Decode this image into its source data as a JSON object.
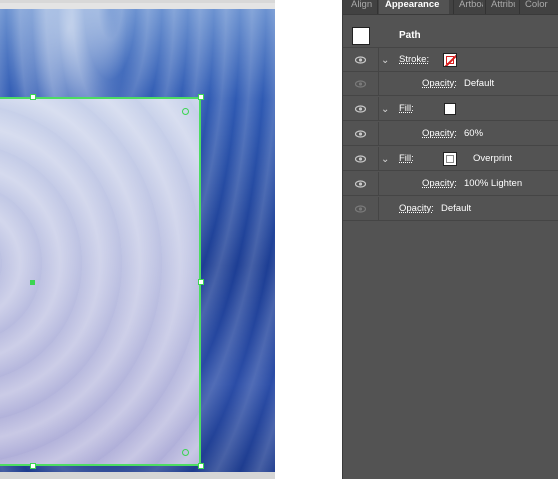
{
  "panel": {
    "tabs": [
      {
        "label": "Align",
        "active": false
      },
      {
        "label": "Appearance",
        "active": true
      },
      {
        "label": "Artboards",
        "active": false
      },
      {
        "label": "Attributes",
        "active": false
      },
      {
        "label": "Color",
        "active": false
      }
    ],
    "object_type": "Path",
    "rows": [
      {
        "kind": "stroke",
        "label": "Stroke:",
        "swatch": "none-icon",
        "visible": true
      },
      {
        "kind": "opacity",
        "label": "Opacity:",
        "value": "Default",
        "visible": false
      },
      {
        "kind": "fill",
        "label": "Fill:",
        "swatch": "white",
        "visible": true
      },
      {
        "kind": "opacity",
        "label": "Opacity:",
        "value": "60%",
        "visible": true
      },
      {
        "kind": "fill",
        "label": "Fill:",
        "swatch": "white-stroke-outline",
        "extra": "Overprint",
        "visible": true
      },
      {
        "kind": "opacity",
        "label": "Opacity:",
        "value": "100% Lighten",
        "visible": true
      },
      {
        "kind": "opacity-top",
        "label": "Opacity:",
        "value": "Default",
        "visible": false
      }
    ]
  },
  "colors": {
    "selection": "#3bd552",
    "panel_bg": "#535353",
    "stroke_none_red": "#d81e1e"
  }
}
